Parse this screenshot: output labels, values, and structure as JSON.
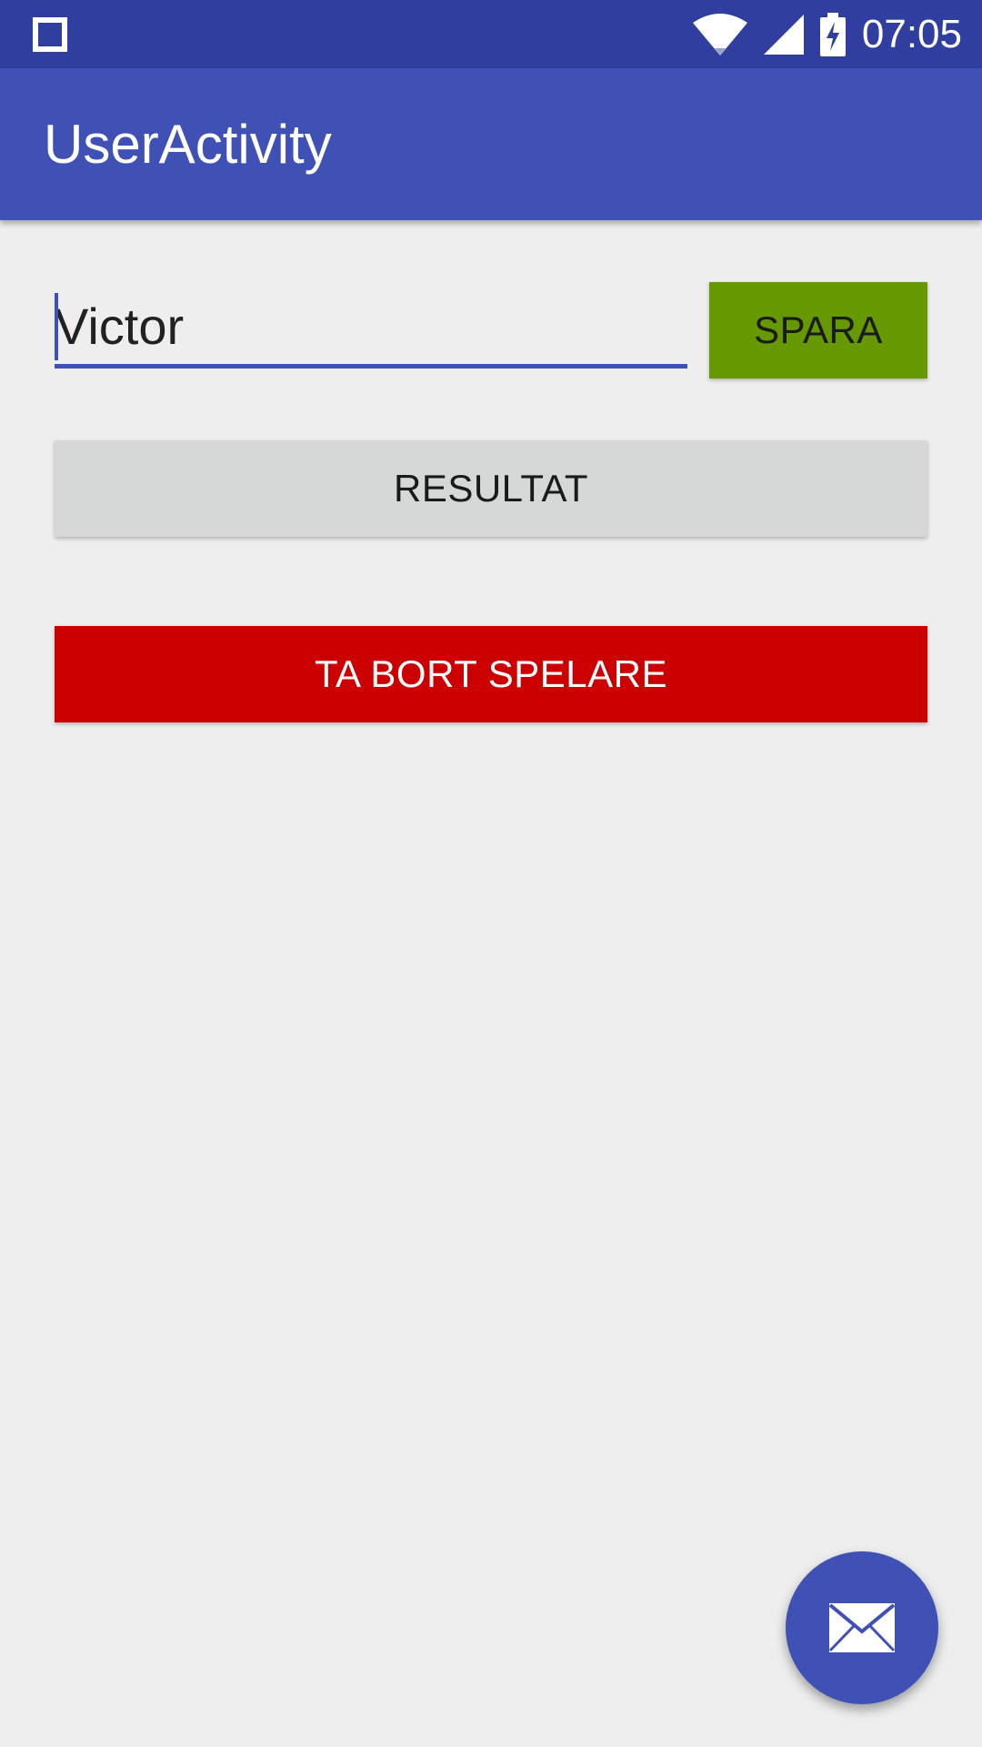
{
  "status_bar": {
    "time": "07:05",
    "icons": [
      "square-notification-icon",
      "wifi-icon",
      "cell-signal-icon",
      "battery-charging-icon"
    ]
  },
  "app_bar": {
    "title": "UserActivity"
  },
  "form": {
    "name_value": "Victor",
    "save_label": "SPARA",
    "result_label": "RESULTAT",
    "delete_label": "TA BORT SPELARE"
  },
  "fab": {
    "icon": "mail-icon"
  },
  "colors": {
    "status_bar": "#303f9f",
    "app_bar": "#3f51b5",
    "save_button": "#669900",
    "result_button": "#d6d7d7",
    "delete_button": "#cc0000",
    "fab": "#3f51b5",
    "background": "#eeeeee"
  }
}
